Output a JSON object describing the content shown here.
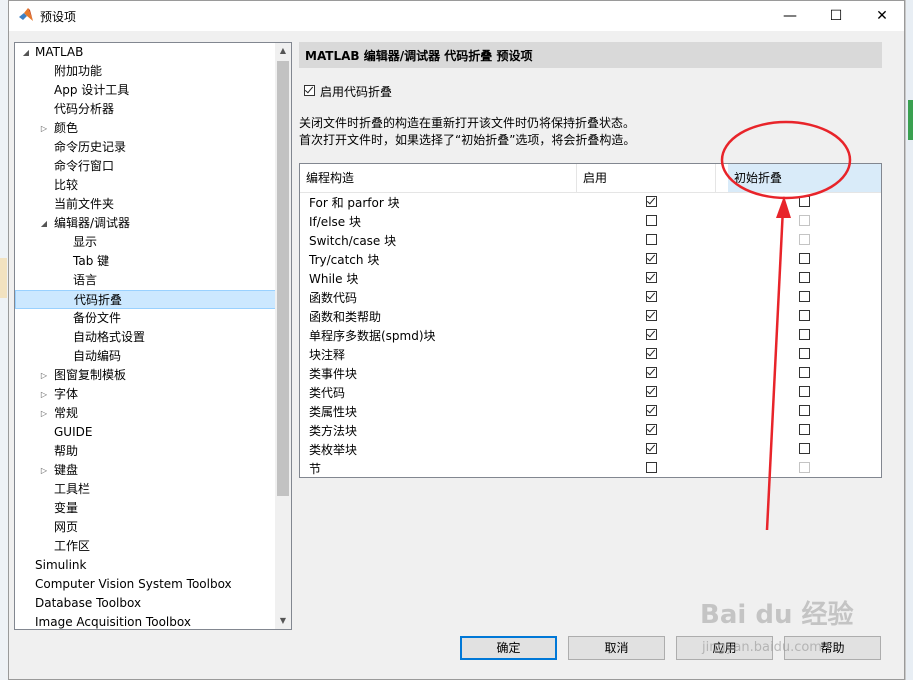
{
  "window": {
    "title": "预设项",
    "minimize": "—",
    "maximize": "☐",
    "close": "✕"
  },
  "tree": {
    "items": [
      {
        "label": "MATLAB",
        "level": 0,
        "arrow": "expanded"
      },
      {
        "label": "附加功能",
        "level": 1,
        "arrow": "none"
      },
      {
        "label": "App 设计工具",
        "level": 1,
        "arrow": "none"
      },
      {
        "label": "代码分析器",
        "level": 1,
        "arrow": "none"
      },
      {
        "label": "颜色",
        "level": 1,
        "arrow": "collapsed"
      },
      {
        "label": "命令历史记录",
        "level": 1,
        "arrow": "none"
      },
      {
        "label": "命令行窗口",
        "level": 1,
        "arrow": "none"
      },
      {
        "label": "比较",
        "level": 1,
        "arrow": "none"
      },
      {
        "label": "当前文件夹",
        "level": 1,
        "arrow": "none"
      },
      {
        "label": "编辑器/调试器",
        "level": 1,
        "arrow": "expanded"
      },
      {
        "label": "显示",
        "level": 2,
        "arrow": "none"
      },
      {
        "label": "Tab 键",
        "level": 2,
        "arrow": "none"
      },
      {
        "label": "语言",
        "level": 2,
        "arrow": "none"
      },
      {
        "label": "代码折叠",
        "level": 2,
        "arrow": "none",
        "selected": true
      },
      {
        "label": "备份文件",
        "level": 2,
        "arrow": "none"
      },
      {
        "label": "自动格式设置",
        "level": 2,
        "arrow": "none"
      },
      {
        "label": "自动编码",
        "level": 2,
        "arrow": "none"
      },
      {
        "label": "图窗复制模板",
        "level": 1,
        "arrow": "collapsed"
      },
      {
        "label": "字体",
        "level": 1,
        "arrow": "collapsed"
      },
      {
        "label": "常规",
        "level": 1,
        "arrow": "collapsed"
      },
      {
        "label": "GUIDE",
        "level": 1,
        "arrow": "none"
      },
      {
        "label": "帮助",
        "level": 1,
        "arrow": "none"
      },
      {
        "label": "键盘",
        "level": 1,
        "arrow": "collapsed"
      },
      {
        "label": "工具栏",
        "level": 1,
        "arrow": "none"
      },
      {
        "label": "变量",
        "level": 1,
        "arrow": "none"
      },
      {
        "label": "网页",
        "level": 1,
        "arrow": "none"
      },
      {
        "label": "工作区",
        "level": 1,
        "arrow": "none"
      },
      {
        "label": "Simulink",
        "level": 0,
        "arrow": "none"
      },
      {
        "label": "Computer Vision System Toolbox",
        "level": 0,
        "arrow": "none"
      },
      {
        "label": "Database Toolbox",
        "level": 0,
        "arrow": "none"
      },
      {
        "label": "Image Acquisition Toolbox",
        "level": 0,
        "arrow": "none"
      }
    ]
  },
  "panel": {
    "title": "MATLAB 编辑器/调试器 代码折叠 预设项",
    "enable_label": "启用代码折叠",
    "enable_checked": true,
    "desc_line1": "关闭文件时折叠的构造在重新打开该文件时仍将保持折叠状态。",
    "desc_line2": "首次打开文件时，如果选择了“初始折叠”选项，将会折叠构造。"
  },
  "table": {
    "headers": {
      "construct": "编程构造",
      "enable": "启用",
      "initial": "初始折叠"
    },
    "rows": [
      {
        "name": "For 和 parfor 块",
        "enable": true,
        "initial": false,
        "initial_disabled": false
      },
      {
        "name": "If/else 块",
        "enable": false,
        "initial": false,
        "initial_disabled": true
      },
      {
        "name": "Switch/case 块",
        "enable": false,
        "initial": false,
        "initial_disabled": true
      },
      {
        "name": "Try/catch 块",
        "enable": true,
        "initial": false,
        "initial_disabled": false
      },
      {
        "name": "While 块",
        "enable": true,
        "initial": false,
        "initial_disabled": false
      },
      {
        "name": "函数代码",
        "enable": true,
        "initial": false,
        "initial_disabled": false
      },
      {
        "name": "函数和类帮助",
        "enable": true,
        "initial": false,
        "initial_disabled": false
      },
      {
        "name": "单程序多数据(spmd)块",
        "enable": true,
        "initial": false,
        "initial_disabled": false
      },
      {
        "name": "块注释",
        "enable": true,
        "initial": false,
        "initial_disabled": false
      },
      {
        "name": "类事件块",
        "enable": true,
        "initial": false,
        "initial_disabled": false
      },
      {
        "name": "类代码",
        "enable": true,
        "initial": false,
        "initial_disabled": false
      },
      {
        "name": "类属性块",
        "enable": true,
        "initial": false,
        "initial_disabled": false
      },
      {
        "name": "类方法块",
        "enable": true,
        "initial": false,
        "initial_disabled": false
      },
      {
        "name": "类枚举块",
        "enable": true,
        "initial": false,
        "initial_disabled": false
      },
      {
        "name": "节",
        "enable": false,
        "initial": false,
        "initial_disabled": true
      }
    ]
  },
  "buttons": {
    "ok": "确定",
    "cancel": "取消",
    "apply": "应用",
    "help": "帮助"
  },
  "watermark": {
    "brand": "Bai du 经验",
    "url": "jingyan.baidu.com"
  },
  "colors": {
    "selection": "#cce8ff",
    "header_highlight": "#d9ebf9",
    "annotation": "#e8242a",
    "default_button_border": "#0078d7"
  }
}
